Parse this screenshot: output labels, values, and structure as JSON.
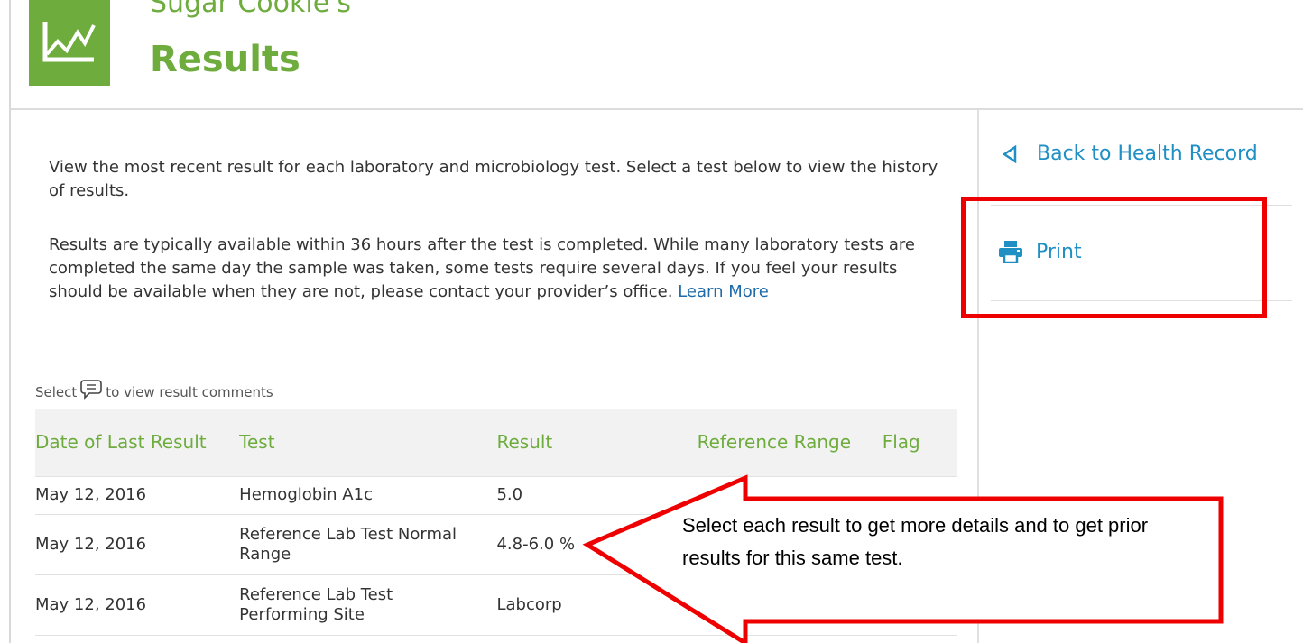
{
  "header": {
    "subtitle": "Sugar Cookie's",
    "title": "Results",
    "logo_icon": "chart-trend-icon",
    "brand_color": "#6eac3e"
  },
  "intro": {
    "paragraph1": "View the most recent result for each laboratory and microbiology test. Select a test below to view the history of results.",
    "paragraph2": "Results are typically available within 36 hours after the test is completed. While many laboratory tests are completed the same day the sample was taken, some tests require several days. If you feel your results should be available when they are not, please contact your provider’s office.",
    "learn_more": "Learn More"
  },
  "comments_hint": {
    "before": "Select",
    "after": "to view result comments",
    "icon": "comment-icon"
  },
  "table": {
    "headers": [
      "Date of Last Result",
      "Test",
      "Result",
      "Reference Range",
      "Flag"
    ],
    "rows": [
      {
        "date": "May 12, 2016",
        "test": "Hemoglobin A1c",
        "result": "5.0",
        "range": "",
        "flag": ""
      },
      {
        "date": "May 12, 2016",
        "test": "Reference Lab Test Normal Range",
        "result": "4.8-6.0 %",
        "range": "",
        "flag": ""
      },
      {
        "date": "May 12, 2016",
        "test": "Reference Lab Test Performing Site",
        "result": "Labcorp",
        "range": "",
        "flag": ""
      }
    ]
  },
  "sidebar": {
    "back_label": "Back to Health Record",
    "back_icon": "triangle-left-icon",
    "print_label": "Print",
    "print_icon": "printer-icon",
    "link_color": "#1f8fc4"
  },
  "callout": {
    "text": "Select each result to get more details and to get prior results for this same test.",
    "border_color": "#ee0000"
  }
}
